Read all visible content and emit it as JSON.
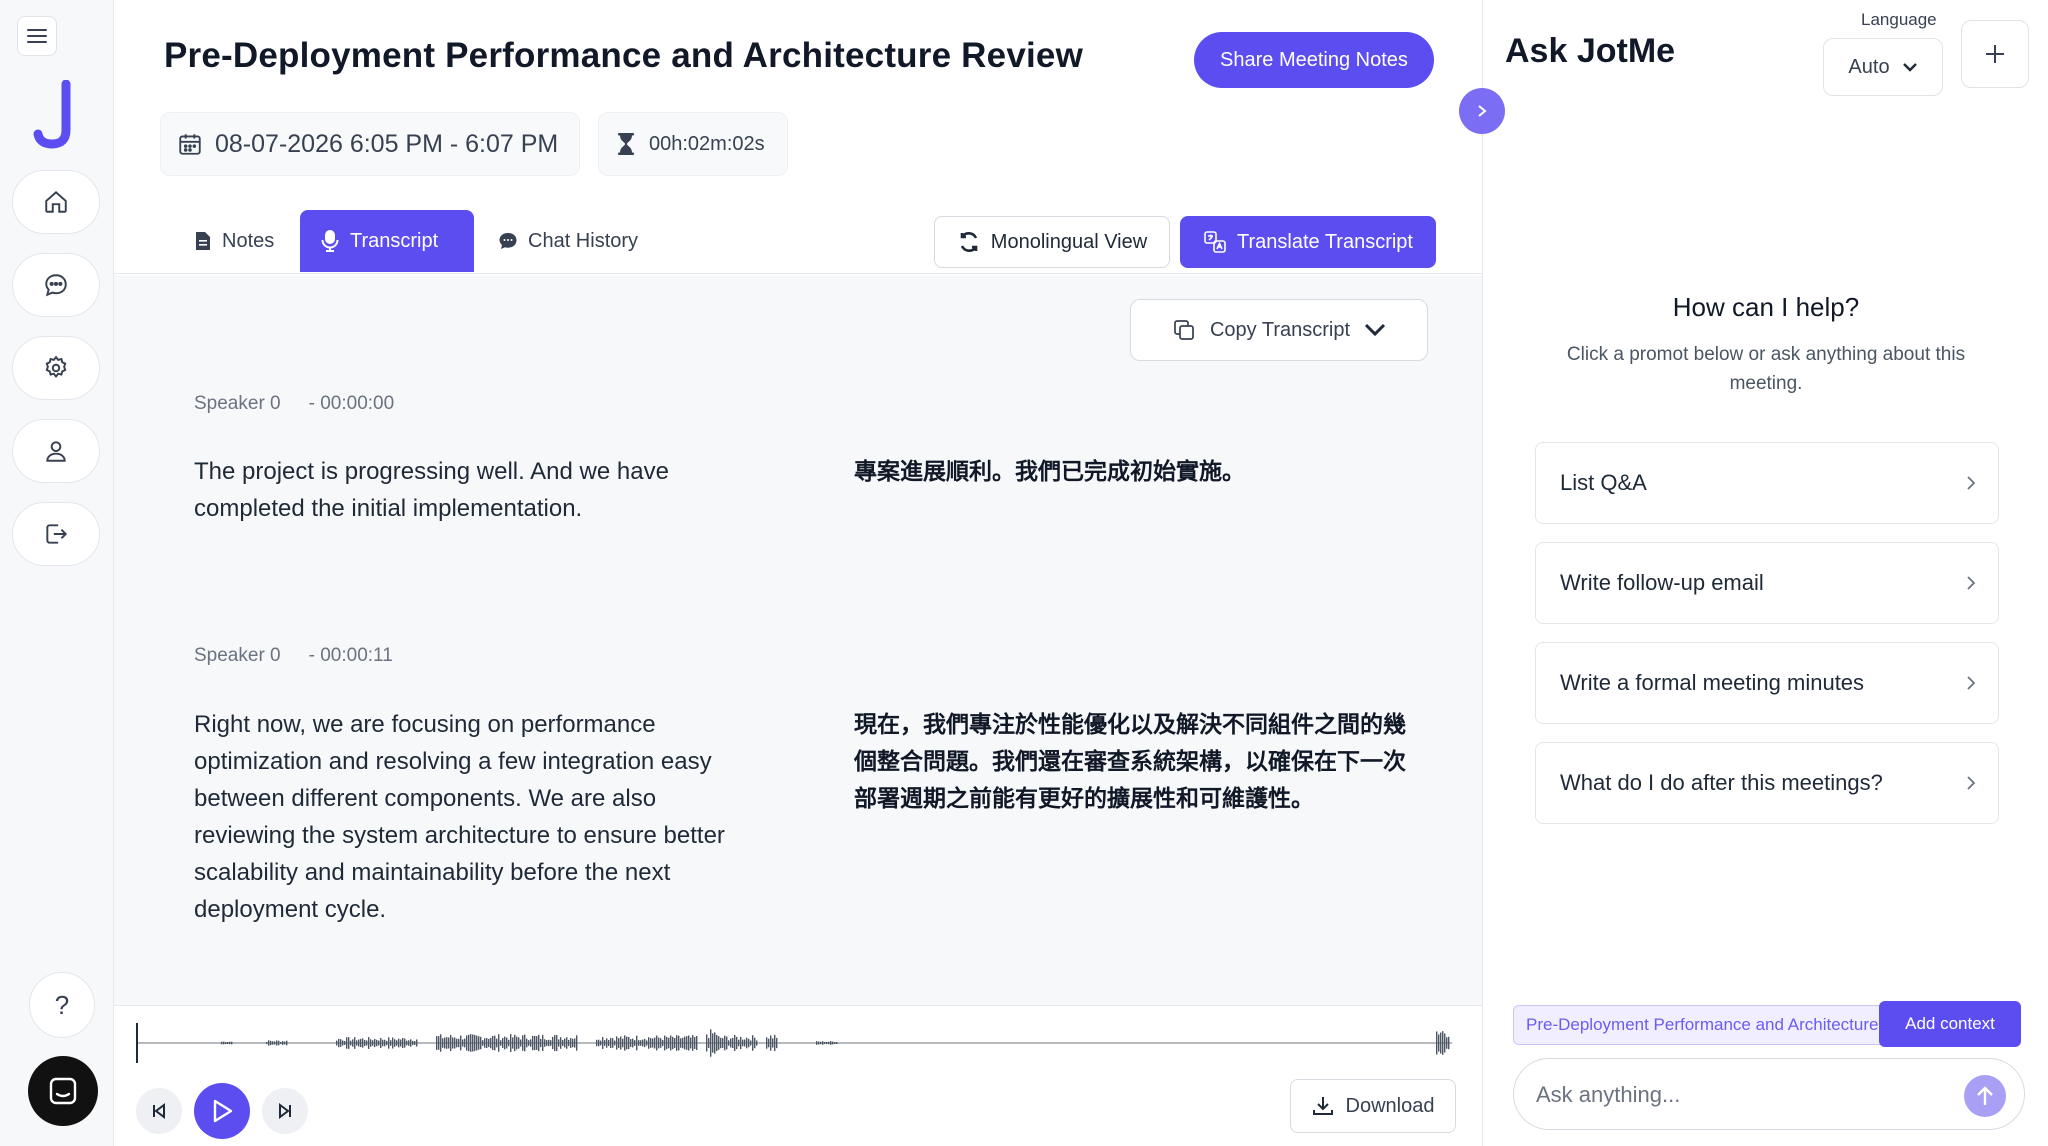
{
  "meeting": {
    "title": "Pre-Deployment Performance and Architecture Review",
    "share_label": "Share Meeting Notes",
    "datetime": "08-07-2026 6:05 PM - 6:07 PM",
    "duration": "00h:02m:02s"
  },
  "tabs": [
    {
      "label": "Notes",
      "icon": "document-icon",
      "active": false
    },
    {
      "label": "Transcript",
      "icon": "microphone-icon",
      "active": true
    },
    {
      "label": "Chat History",
      "icon": "chat-icon",
      "active": false
    }
  ],
  "view": {
    "mono_label": "Monolingual View",
    "translate_label": "Translate Transcript",
    "copy_label": "Copy Transcript"
  },
  "segments": [
    {
      "speaker": "Speaker 0",
      "time": "- 00:00:00",
      "text": "The project is progressing well. And we have completed the initial implementation.",
      "translation": "專案進展順利。我們已完成初始實施。"
    },
    {
      "speaker": "Speaker 0",
      "time": "- 00:00:11",
      "text": "Right now, we are focusing on performance optimization and resolving a few integration easy between different components. We are also reviewing the system architecture to ensure better scalability and maintainability before the next deployment cycle.",
      "translation": "現在，我們專注於性能優化以及解決不同組件之間的幾個整合問題。我們還在審查系統架構，以確保在下一次部署週期之前能有更好的擴展性和可維護性。"
    }
  ],
  "player": {
    "download_label": "Download",
    "progress": 0
  },
  "assistant": {
    "title": "Ask JotMe",
    "language_label": "Language",
    "language_value": "Auto",
    "help_title": "How can I help?",
    "help_sub": "Click a promot below or ask anything about this meeting.",
    "prompts": [
      "List Q&A",
      "Write follow-up email",
      "Write a formal meeting minutes",
      "What do I do after this meetings?"
    ],
    "context_chip": "Pre-Deployment Performance and Architecture Review",
    "add_context_label": "Add context",
    "input_placeholder": "Ask anything..."
  },
  "colors": {
    "accent": "#5b4df0",
    "accent_light": "#a99ff5",
    "logo": "#5b4df0"
  },
  "help_icon": "?"
}
